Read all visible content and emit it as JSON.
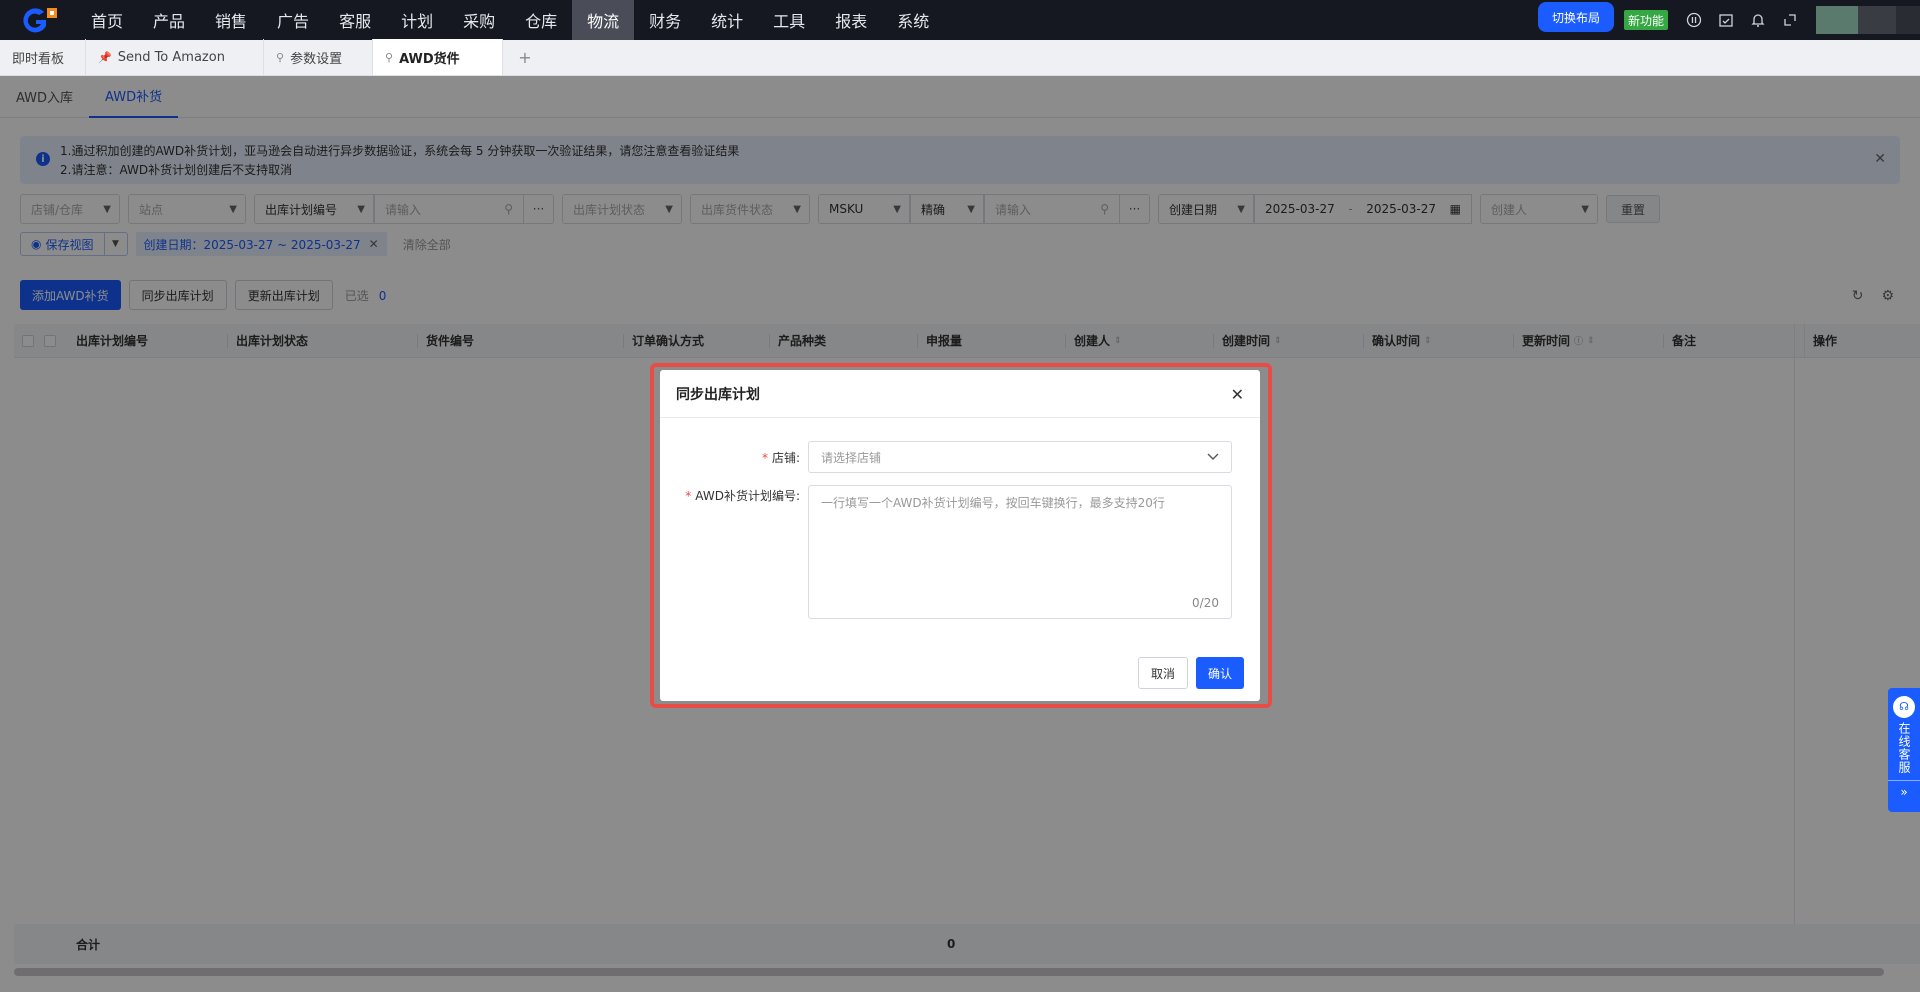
{
  "nav": {
    "items": [
      "首页",
      "产品",
      "销售",
      "广告",
      "客服",
      "计划",
      "采购",
      "仓库",
      "物流",
      "财务",
      "统计",
      "工具",
      "报表",
      "系统"
    ],
    "active_index": 8,
    "switch_layout": "切换布局",
    "new_feature": "新功能"
  },
  "tabs": {
    "items": [
      {
        "label": "即时看板",
        "pinned": false
      },
      {
        "label": "Send To Amazon",
        "pinned": true
      },
      {
        "label": "参数设置",
        "pinned": true
      },
      {
        "label": "AWD货件",
        "pinned": true
      }
    ],
    "active_index": 3,
    "add": "+"
  },
  "subtabs": {
    "items": [
      "AWD入库",
      "AWD补货"
    ],
    "active_index": 1
  },
  "notice": {
    "line1": "1.通过积加创建的AWD补货计划，亚马逊会自动进行异步数据验证，系统会每 5 分钟获取一次验证结果，请您注意查看验证结果",
    "line2": "2.请注意：AWD补货计划创建后不支持取消"
  },
  "filters": {
    "store_warehouse": "店铺/仓库",
    "site": "站点",
    "plan_no_type": "出库计划编号",
    "input_placeholder": "请输入",
    "plan_status": "出库计划状态",
    "shipment_status": "出库货件状态",
    "msku": "MSKU",
    "exact": "精确",
    "msku_placeholder": "请输入",
    "date_type": "创建日期",
    "date_start": "2025-03-27",
    "date_sep": "-",
    "date_end": "2025-03-27",
    "creator": "创建人",
    "reset": "重置"
  },
  "filters2": {
    "save_view": "保存视图",
    "chip": "创建日期：2025-03-27 ~ 2025-03-27",
    "clear_all": "清除全部"
  },
  "actions": {
    "add": "添加AWD补货",
    "sync": "同步出库计划",
    "update": "更新出库计划",
    "selected_label": "已选",
    "selected_count": "0"
  },
  "table": {
    "columns": [
      "出库计划编号",
      "出库计划状态",
      "货件编号",
      "订单确认方式",
      "产品种类",
      "申报量",
      "创建人",
      "创建时间",
      "确认时间",
      "更新时间",
      "备注",
      "操作"
    ],
    "footer_label": "合计",
    "footer_total": "0"
  },
  "modal": {
    "title": "同步出库计划",
    "store_label": "店铺:",
    "store_placeholder": "请选择店铺",
    "plan_label": "AWD补货计划编号:",
    "plan_placeholder": "一行填写一个AWD补货计划编号，按回车键换行，最多支持20行",
    "counter": "0/20",
    "cancel": "取消",
    "confirm": "确认"
  },
  "side_service": {
    "text": "在线客服",
    "arrow": "»"
  },
  "colors": {
    "primary": "#1a5cff",
    "nav_bg": "#151821",
    "highlight": "#e84c47",
    "new_badge": "#35a844"
  }
}
